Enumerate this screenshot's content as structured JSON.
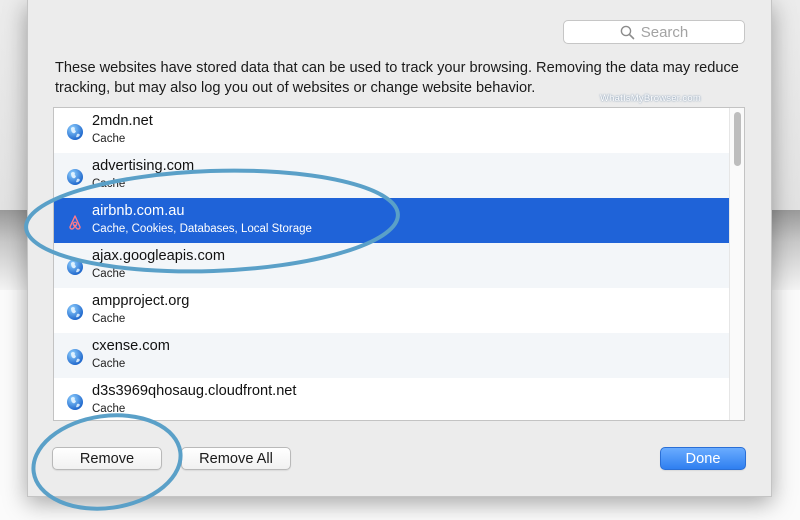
{
  "search": {
    "placeholder": "Search",
    "icon": "magnifier-icon"
  },
  "description": "These websites have stored data that can be used to track your browsing. Removing the data may reduce tracking, but may also log you out of websites or change website behavior.",
  "watermark": "WhatIsMyBrowser.com",
  "sites": [
    {
      "name": "2mdn.net",
      "types": "Cache",
      "icon": "globe-icon",
      "selected": false
    },
    {
      "name": "advertising.com",
      "types": "Cache",
      "icon": "globe-icon",
      "selected": false
    },
    {
      "name": "airbnb.com.au",
      "types": "Cache, Cookies, Databases, Local Storage",
      "icon": "airbnb-icon",
      "selected": true
    },
    {
      "name": "ajax.googleapis.com",
      "types": "Cache",
      "icon": "globe-icon",
      "selected": false
    },
    {
      "name": "ampproject.org",
      "types": "Cache",
      "icon": "globe-icon",
      "selected": false
    },
    {
      "name": "cxense.com",
      "types": "Cache",
      "icon": "globe-icon",
      "selected": false
    },
    {
      "name": "d3s3969qhosaug.cloudfront.net",
      "types": "Cache",
      "icon": "globe-icon",
      "selected": false
    }
  ],
  "buttons": {
    "remove": "Remove",
    "remove_all": "Remove All",
    "done": "Done"
  },
  "colors": {
    "selection": "#1f63d8",
    "annotation": "#5aa0c8",
    "primary_button": "#2f7ff0"
  }
}
